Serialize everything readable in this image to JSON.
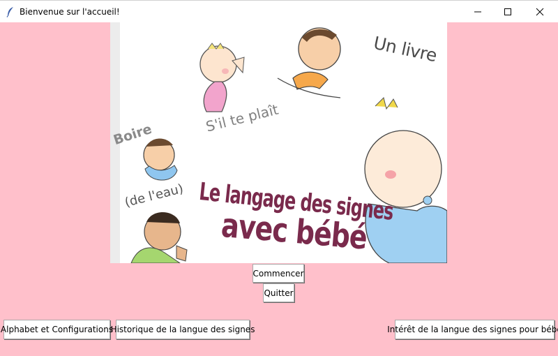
{
  "window": {
    "title": "Bienvenue sur l'accueil!",
    "app_icon": "feather-icon",
    "controls": [
      "minimize-icon",
      "maximize-icon",
      "close-icon"
    ]
  },
  "banner": {
    "texts": {
      "un_livre": "Un livre",
      "sil_te_plait": "S'il te plaît",
      "boire": "Boire",
      "de_leau": "(de l'eau)",
      "title_line1": "Le langage des signes",
      "title_line2": "avec bébé"
    },
    "colors": {
      "title": "#7a2a4c",
      "gray_text": "#808080"
    }
  },
  "buttons": {
    "start": "Commencer",
    "quit": "Quitter",
    "alphabet": "Alphabet et Configurations",
    "history": "Historique de la langue des signes",
    "interest": "Intérêt de la langue des signes pour bébé"
  },
  "colors": {
    "background": "#ffc0cb",
    "titlebar": "#ffffff"
  }
}
